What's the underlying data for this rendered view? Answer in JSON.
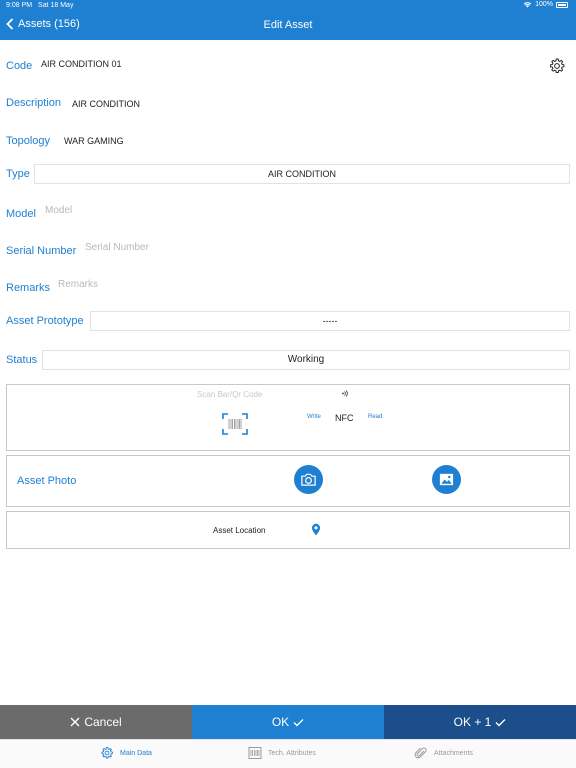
{
  "status_bar": {
    "time": "9:08 PM",
    "date": "Sat 18 May",
    "battery": "100%"
  },
  "nav": {
    "back_label": "Assets (156)",
    "title": "Edit Asset"
  },
  "form": {
    "code": {
      "label": "Code",
      "value": "AIR CONDITION 01"
    },
    "description": {
      "label": "Description",
      "value": "AIR CONDITION"
    },
    "topology": {
      "label": "Topology",
      "value": "WAR GAMING"
    },
    "type": {
      "label": "Type",
      "value": "AIR CONDITION"
    },
    "model": {
      "label": "Model",
      "placeholder": "Model"
    },
    "serial_number": {
      "label": "Serial Number",
      "placeholder": "Serial Number"
    },
    "remarks": {
      "label": "Remarks",
      "placeholder": "Remarks"
    },
    "asset_prototype": {
      "label": "Asset Prototype",
      "value": "-----"
    },
    "status": {
      "label": "Status",
      "value": "Working"
    }
  },
  "scan": {
    "title": "Scan Bar/Qr Code",
    "nfc_label": "NFC",
    "write_label": "Write",
    "read_label": "Read"
  },
  "photo": {
    "label": "Asset Photo"
  },
  "location": {
    "label": "Asset Location"
  },
  "actions": {
    "cancel": "Cancel",
    "ok": "OK",
    "ok_plus": "OK + 1"
  },
  "tabs": [
    {
      "label": "Main Data",
      "icon": "gear-icon"
    },
    {
      "label": "Tech. Attributes",
      "icon": "barcode-icon"
    },
    {
      "label": "Attachments",
      "icon": "paperclip-icon"
    }
  ],
  "colors": {
    "accent": "#1f7fd0",
    "dark_accent": "#1b4e8a",
    "cancel": "#6b6b6b",
    "placeholder": "#b9b9b9"
  }
}
